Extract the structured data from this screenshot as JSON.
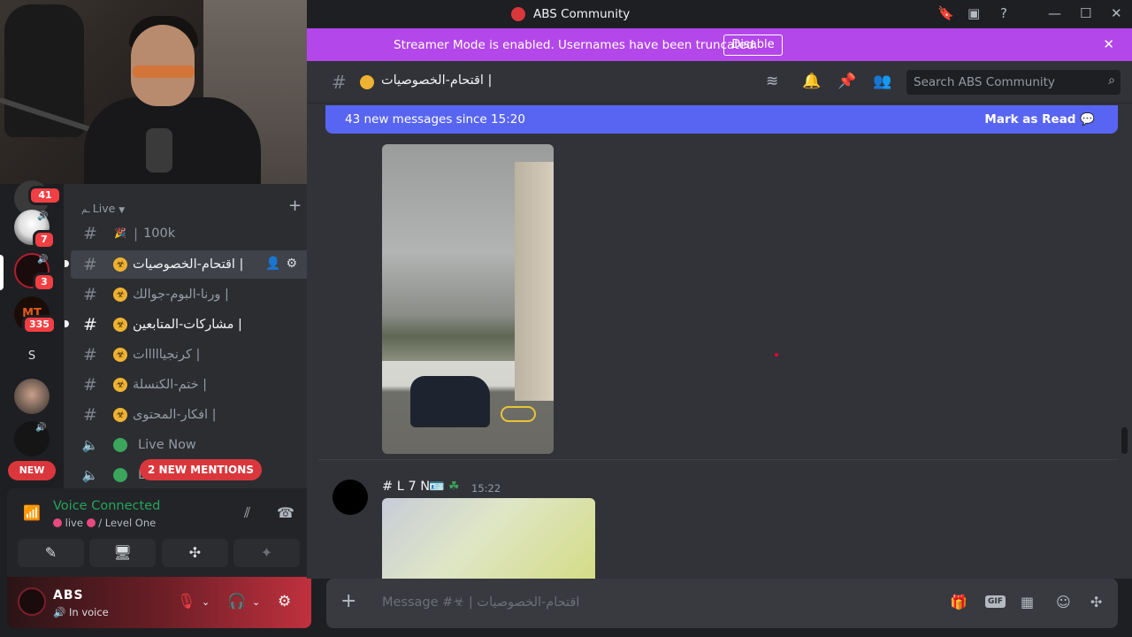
{
  "app": {
    "window_title": "ABS Community"
  },
  "streamer_banner": {
    "message": "Streamer Mode is enabled. Usernames have been truncated.",
    "button": "Disable"
  },
  "channel_header": {
    "title": "اقتحام-الخصوصيات |",
    "search_placeholder": "Search ABS Community"
  },
  "new_messages_bar": {
    "text": "43 new messages since 15:20",
    "action": "Mark as Read"
  },
  "servers": [
    {
      "badge": "41"
    },
    {
      "badge": "7"
    },
    {
      "badge": "3"
    },
    {
      "badge": "335",
      "label": "MT"
    },
    {
      "label": "S"
    },
    {
      "badge": ""
    },
    {
      "badge": ""
    }
  ],
  "rail_new_label": "NEW",
  "sidebar": {
    "category": "Live",
    "channels": [
      {
        "name": "100k",
        "type": "text"
      },
      {
        "name": "اقتحام-الخصوصيات |",
        "type": "text",
        "active": true
      },
      {
        "name": "ورنا-البوم-جوالك |",
        "type": "text"
      },
      {
        "name": "مشاركات-المتابعين |",
        "type": "text",
        "unread": true
      },
      {
        "name": "كرنجيااااات |",
        "type": "text"
      },
      {
        "name": "ختم-الكنسلة |",
        "type": "text"
      },
      {
        "name": "افكار-المحتوى |",
        "type": "text"
      },
      {
        "name": "Live Now",
        "type": "voice"
      },
      {
        "name": "L",
        "type": "voice"
      }
    ],
    "mentions_pill": "2 NEW MENTIONS"
  },
  "voice_panel": {
    "status": "Voice Connected",
    "channel_prefix": "live",
    "channel_suffix": "/ Level One"
  },
  "user_panel": {
    "username": "ABS",
    "status": "In voice"
  },
  "messages": [
    {
      "author": "# L 7 N",
      "time": "15:22"
    }
  ],
  "composer": {
    "placeholder": "Message #☣ | اقتحام-الخصوصيات",
    "gif_label": "GIF"
  },
  "colors": {
    "brand": "#5865f2",
    "streamer": "#b347ea",
    "danger": "#da373c",
    "online": "#23a55a"
  }
}
